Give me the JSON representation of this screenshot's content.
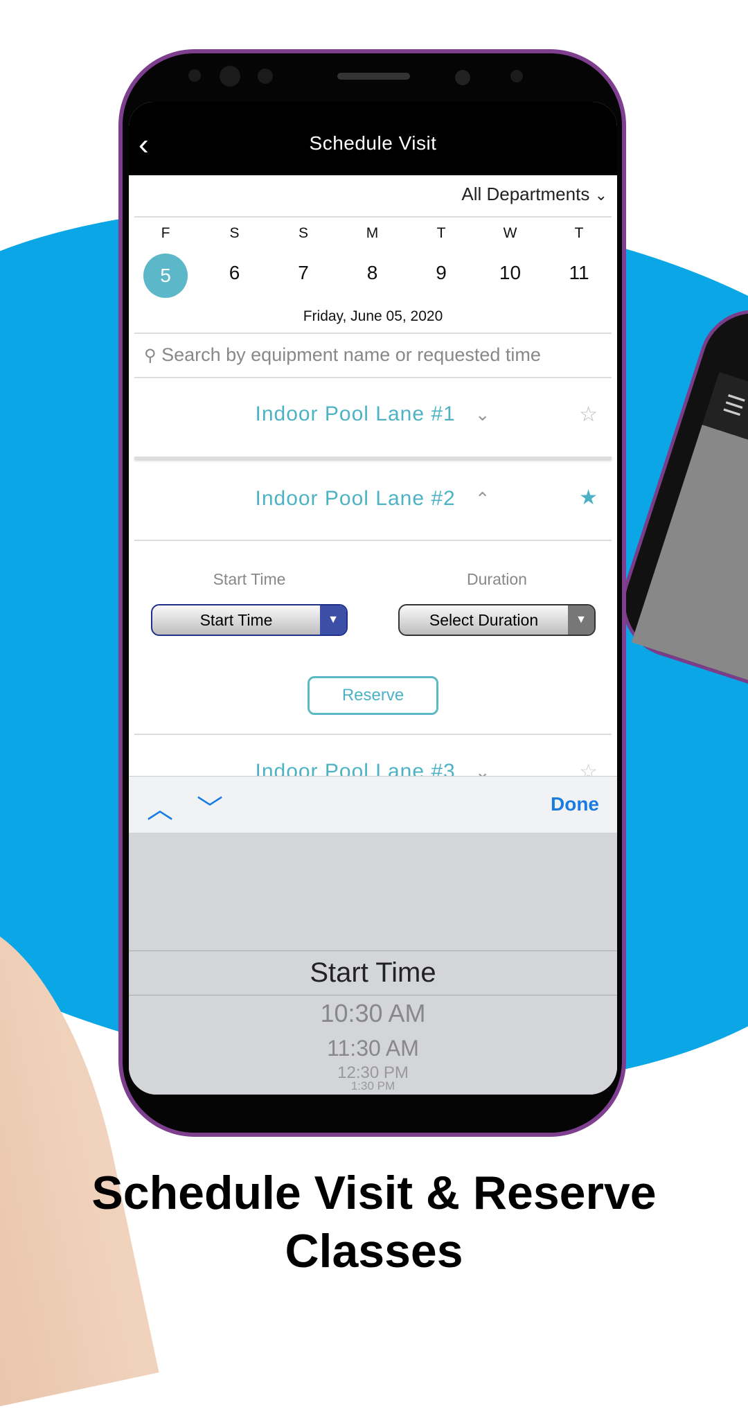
{
  "nav": {
    "title": "Schedule Visit",
    "back_icon": "chevron-left-icon"
  },
  "filter": {
    "department": "All Departments"
  },
  "calendar": {
    "days": [
      {
        "letter": "F",
        "num": "5",
        "selected": true
      },
      {
        "letter": "S",
        "num": "6"
      },
      {
        "letter": "S",
        "num": "7"
      },
      {
        "letter": "M",
        "num": "8"
      },
      {
        "letter": "T",
        "num": "9"
      },
      {
        "letter": "W",
        "num": "10"
      },
      {
        "letter": "T",
        "num": "11"
      }
    ],
    "selected_date": "Friday, June 05, 2020"
  },
  "search": {
    "placeholder": "Search by equipment name or requested time"
  },
  "lanes": [
    {
      "name": "Indoor Pool Lane #1",
      "expanded": false,
      "favorite": false
    },
    {
      "name": "Indoor Pool Lane #2",
      "expanded": true,
      "favorite": true
    },
    {
      "name": "Indoor Pool Lane #3",
      "expanded": false,
      "favorite": false
    }
  ],
  "reservation": {
    "start_label": "Start Time",
    "start_value": "Start Time",
    "duration_label": "Duration",
    "duration_value": "Select Duration",
    "reserve": "Reserve"
  },
  "toolbar": {
    "done": "Done"
  },
  "picker": {
    "title": "Start Time",
    "options": [
      "10:30 AM",
      "11:30 AM",
      "12:30 PM",
      "1:30 PM"
    ]
  },
  "caption": {
    "line1": "Schedule Visit & Reserve",
    "line2": "Classes"
  },
  "colors": {
    "accent": "#4db3c4",
    "background_blue": "#0aa6e6",
    "phone_frame": "#7d3f8e",
    "ios_blue": "#1a7be0"
  }
}
